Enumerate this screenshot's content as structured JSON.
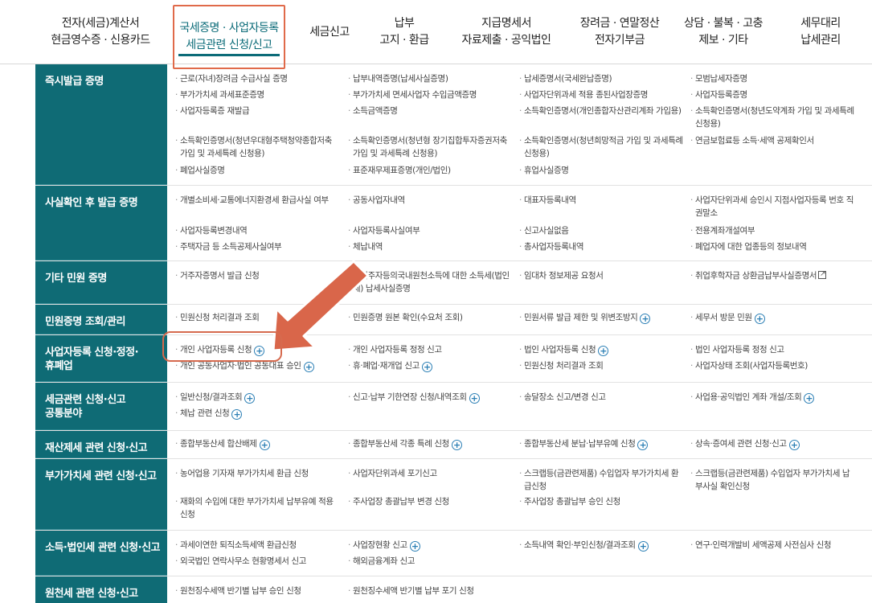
{
  "nav": [
    {
      "line1": "전자(세금)계산서",
      "line2": "현금영수증 · 신용카드"
    },
    {
      "line1": "국세증명 · 사업자등록",
      "line2": "세금관련 신청/신고"
    },
    {
      "line1": "세금신고",
      "line2": ""
    },
    {
      "line1": "납부",
      "line2": "고지 · 환급"
    },
    {
      "line1": "지급명세서",
      "line2": "자료제출 · 공익법인"
    },
    {
      "line1": "장려금 · 연말정산",
      "line2": "전자기부금"
    },
    {
      "line1": "상담 · 불복 · 고충",
      "line2": "제보 · 기타"
    },
    {
      "line1": "세무대리",
      "line2": "납세관리"
    }
  ],
  "sections": [
    {
      "head": [
        "즉시발급 증명"
      ],
      "cells": [
        [
          "근로(자녀)장려금 수급사실 증명",
          "납부내역증명(납세사실증명)",
          "납세증명서(국세완납증명)",
          "모범납세자증명"
        ],
        [
          "부가가치세 과세표준증명",
          "부가가치세 면세사업자 수입금액증명",
          "사업자단위과세 적용 종된사업장증명",
          "사업자등록증명"
        ],
        [
          "사업자등록증 재발급",
          "소득금액증명",
          "소득확인증명서(개인종합자산관리계좌 가입용)",
          "소득확인증명서(청년도약계좌 가입 및 과세특례 신청용)"
        ],
        [
          "소득확인증명서(청년우대형주택청약종합저축 가입 및 과세특례 신청용)",
          "소득확인증명서(청년형 장기집합투자증권저축 가입 및 과세특례 신청용)",
          "소득확인증명서(청년희망적금 가입 및 과세특례 신청용)",
          "연금보험료등 소득·세액 공제확인서"
        ],
        [
          "폐업사실증명",
          "표준재무제표증명(개인/법인)",
          "휴업사실증명",
          ""
        ]
      ]
    },
    {
      "head": [
        "사실확인 후 발급 증명"
      ],
      "cells": [
        [
          "개별소비세·교통에너지환경세 환급사실 여부",
          "공동사업자내역",
          "대표자등록내역",
          "사업자단위과세 승인시 지점사업자등록 번호 직권말소"
        ],
        [
          "사업자등록변경내역",
          "사업자등록사실여부",
          "신고사실없음",
          "전용계좌개설여부"
        ],
        [
          "주택자금 등 소득공제사실여부",
          "체납내역",
          "총사업자등록내역",
          "폐업자에 대한 업종등의 정보내역"
        ]
      ]
    },
    {
      "head": [
        "기타 민원 증명"
      ],
      "cells": [
        [
          "거주자증명서 발급 신청",
          "비거주자등의국내원천소득에 대한 소득세(법인세) 납세사실증명",
          "임대차 정보제공 요청서",
          "취업후학자금 상환금납부사실증명서"
        ]
      ]
    },
    {
      "head": [
        "민원증명 조회/관리"
      ],
      "cells": [
        [
          "민원신청 처리결과 조회",
          "민원증명 원본 확인(수요처 조회)",
          "민원서류 발급 제한 및 위변조방지",
          "세무서 방문 민원"
        ]
      ]
    },
    {
      "head": [
        "사업자등록 신청·정정·",
        "휴폐업"
      ],
      "cells": [
        [
          "개인 사업자등록 신청",
          "개인 사업자등록 정정 신고",
          "법인 사업자등록 신청",
          "법인 사업자등록 정정 신고"
        ],
        [
          "개인 공동사업자·법인 공동대표 승인",
          "휴·폐업·재개업 신고",
          "민원신청 처리결과 조회",
          "사업자상태 조회(사업자등록번호)"
        ]
      ]
    },
    {
      "head": [
        "세금관련 신청·신고",
        "공통분야"
      ],
      "cells": [
        [
          "일반신청/결과조회",
          "신고·납부 기한연장 신청/내역조회",
          "송달장소 신고/변경 신고",
          "사업용·공익법인 계좌 개설/조회"
        ],
        [
          "체납 관련 신청",
          "",
          "",
          ""
        ]
      ]
    },
    {
      "head": [
        "재산제세 관련 신청·신고"
      ],
      "cells": [
        [
          "종합부동산세 합산배제",
          "종합부동산세 각종 특례 신청",
          "종합부동산세 분납·납부유예 신청",
          "상속·증여세 관련 신청·신고"
        ]
      ]
    },
    {
      "head": [
        "부가가치세 관련 신청·신고"
      ],
      "cells": [
        [
          "농어업용 기자재 부가가치세 환급 신청",
          "사업자단위과세 포기신고",
          "스크랩등(금관련제품) 수입업자 부가가치세 환급신청",
          "스크랩등(금관련제품) 수입업자 부가가치세 납부사실 확인신청"
        ],
        [
          "재화의 수입에 대한 부가가치세 납부유예 적용 신청",
          "주사업장 총괄납부 변경 신청",
          "주사업장 총괄납부 승인 신청",
          ""
        ]
      ]
    },
    {
      "head": [
        "소득·법인세 관련 신청·신고"
      ],
      "cells": [
        [
          "과세이연한 퇴직소득세액 환급신청",
          "사업장현황 신고",
          "소득내역 확인·부인신청/결과조회",
          "연구·인력개발비 세액공제 사전심사 신청"
        ],
        [
          "외국법인 연락사무소 현황명세서 신고",
          "해외금융계좌 신고",
          "",
          ""
        ]
      ]
    },
    {
      "head": [
        "원천세 관련 신청·신고"
      ],
      "cells": [
        [
          "원천징수세액 반기별 납부 승인 신청",
          "원천징수세액 반기별 납부 포기 신청",
          "",
          ""
        ]
      ]
    }
  ],
  "colors": {
    "accent": "#0f6b75",
    "highlight": "#d66a4e",
    "plus": "#2b7fb5"
  }
}
